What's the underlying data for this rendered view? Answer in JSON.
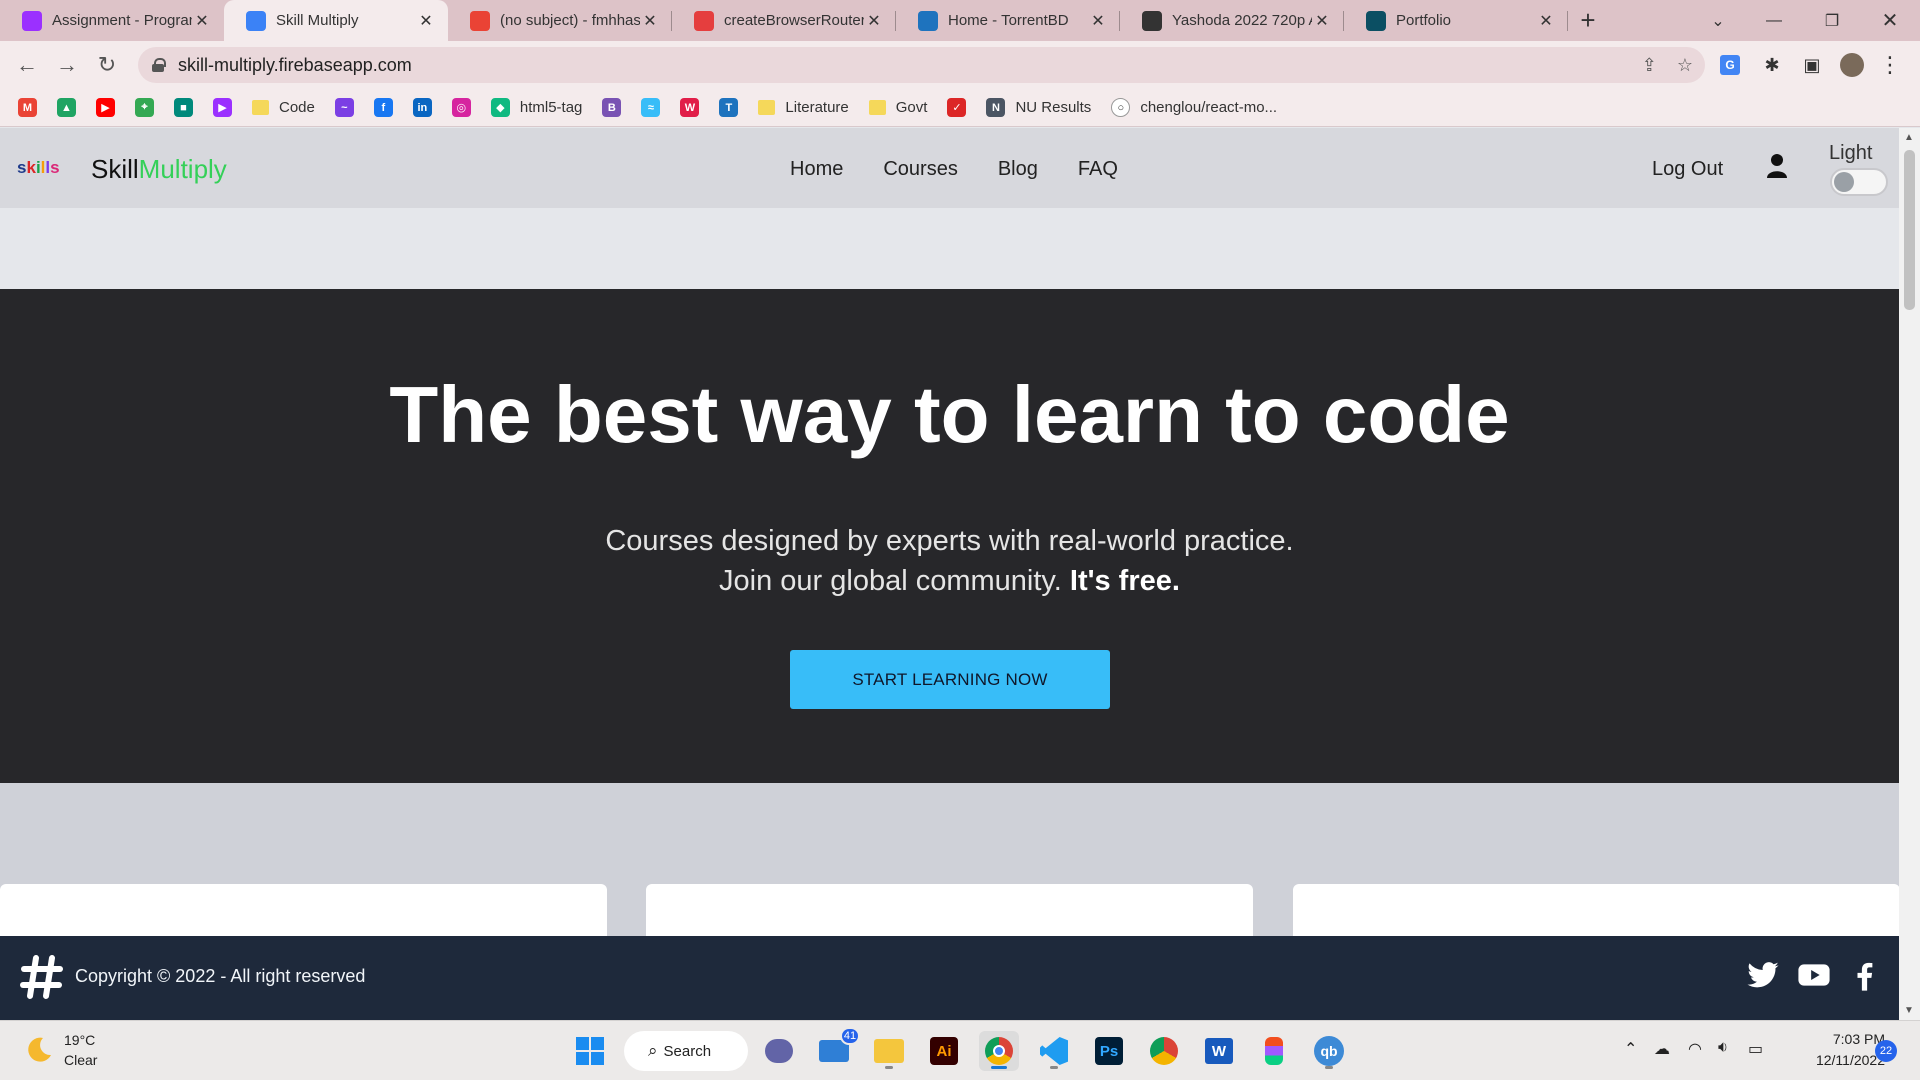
{
  "browser": {
    "tabs": [
      {
        "title": "Assignment - Progran",
        "favicon": "purple-play-icon",
        "color": "#9b30ff"
      },
      {
        "title": "Skill Multiply",
        "favicon": "skill-multiply-icon",
        "color": "#3b82f6"
      },
      {
        "title": "(no subject) - fmhhas",
        "favicon": "gmail-icon",
        "color": "#ea4335"
      },
      {
        "title": "createBrowserRouter",
        "favicon": "react-router-icon",
        "color": "#e53e3e"
      },
      {
        "title": "Home - TorrentBD",
        "favicon": "torrentbd-icon",
        "color": "#1e73be"
      },
      {
        "title": "Yashoda 2022 720p A",
        "favicon": "globe-icon",
        "color": "#333333"
      },
      {
        "title": "Portfolio",
        "favicon": "react-icon",
        "color": "#0b4f63"
      }
    ],
    "url": "skill-multiply.firebaseapp.com",
    "bookmarks": [
      {
        "label": "",
        "icon": "gmail-icon",
        "color": "#ea4335",
        "glyph": "M"
      },
      {
        "label": "",
        "icon": "drive-icon",
        "color": "#1fa463",
        "glyph": "▲"
      },
      {
        "label": "",
        "icon": "youtube-icon",
        "color": "#ff0000",
        "glyph": "▶"
      },
      {
        "label": "",
        "icon": "maps-icon",
        "color": "#34a853",
        "glyph": "⌖"
      },
      {
        "label": "",
        "icon": "meet-icon",
        "color": "#00897b",
        "glyph": "■"
      },
      {
        "label": "",
        "icon": "programming-hero-icon",
        "color": "#9b30ff",
        "glyph": "▶"
      },
      {
        "label": "Code",
        "icon": "folder-icon",
        "folder": true
      },
      {
        "label": "",
        "icon": "messenger-icon",
        "color": "#7b3fe4",
        "glyph": "~"
      },
      {
        "label": "",
        "icon": "facebook-icon",
        "color": "#1877f2",
        "glyph": "f"
      },
      {
        "label": "",
        "icon": "linkedin-icon",
        "color": "#0a66c2",
        "glyph": "in"
      },
      {
        "label": "",
        "icon": "instagram-icon",
        "color": "#d6249f",
        "glyph": "◎"
      },
      {
        "label": "html5-tag",
        "icon": "html5-tag-icon",
        "color": "#10b981",
        "glyph": "◆"
      },
      {
        "label": "",
        "icon": "bootstrap-icon",
        "color": "#7952b3",
        "glyph": "B"
      },
      {
        "label": "",
        "icon": "tailwind-icon",
        "color": "#38bdf8",
        "glyph": "≈"
      },
      {
        "label": "",
        "icon": "w3schools-icon",
        "color": "#e11d48",
        "glyph": "W"
      },
      {
        "label": "",
        "icon": "torrentbd-icon",
        "color": "#1e73be",
        "glyph": "T"
      },
      {
        "label": "Literature",
        "icon": "folder-icon",
        "folder": true
      },
      {
        "label": "Govt",
        "icon": "folder-icon",
        "folder": true
      },
      {
        "label": "",
        "icon": "tick-icon",
        "color": "#dc2626",
        "glyph": "✓"
      },
      {
        "label": "NU Results",
        "icon": "nu-icon",
        "color": "#4b5563",
        "glyph": "N"
      },
      {
        "label": "chenglou/react-mo...",
        "icon": "github-icon",
        "color": "#ffffff",
        "glyph": "○",
        "dark": true
      }
    ]
  },
  "site": {
    "logo_letters": [
      "s",
      "k",
      "i",
      "l",
      "l",
      "s"
    ],
    "brand_main": "Skill",
    "brand_accent": "Multiply",
    "nav": [
      "Home",
      "Courses",
      "Blog",
      "FAQ"
    ],
    "logout": "Log Out",
    "theme_label": "Light",
    "hero": {
      "title": "The best way to learn to code",
      "line1": "Courses designed by experts with real-world practice.",
      "line2": "Join our global community.",
      "line2_bold": "It's free.",
      "cta": "START LEARNING NOW"
    },
    "footer": {
      "copyright": "Copyright © 2022 - All right reserved"
    },
    "colors": {
      "accent": "#34d058",
      "cta": "#38bdf8",
      "hero_bg": "#27272a",
      "footer_bg": "#1e293b"
    }
  },
  "taskbar": {
    "weather_temp": "19°C",
    "weather_desc": "Clear",
    "search": "Search",
    "mail_badge": "41",
    "time": "7:03 PM",
    "date": "12/11/2022",
    "notifications": "22"
  }
}
